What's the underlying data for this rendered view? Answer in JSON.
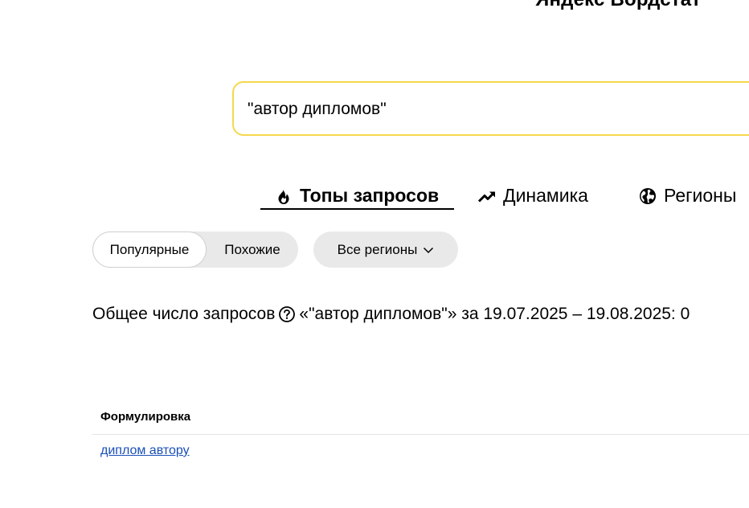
{
  "header": {
    "brand_title": "Яндекс Вордстат"
  },
  "search": {
    "value": "\"автор дипломов\""
  },
  "tabs": [
    {
      "label": "Топы запросов",
      "icon": "fire-icon",
      "active": true
    },
    {
      "label": "Динамика",
      "icon": "trend-up-icon",
      "active": false
    },
    {
      "label": "Регионы",
      "icon": "globe-icon",
      "active": false
    }
  ],
  "filters": {
    "popular_label": "Популярные",
    "similar_label": "Похожие",
    "region_label": "Все регионы",
    "selected": "Популярные"
  },
  "summary": {
    "prefix": "Общее число запросов",
    "query_part": "«\"автор дипломов\"» за 19.07.2025 – 19.08.2025: 0"
  },
  "table": {
    "header": "Формулировка",
    "rows": [
      {
        "phrase": "диплом автору"
      }
    ]
  },
  "colors": {
    "search_border": "#f5d84d",
    "link": "#1a4fb8",
    "pill_bg": "#e9e9e9"
  }
}
